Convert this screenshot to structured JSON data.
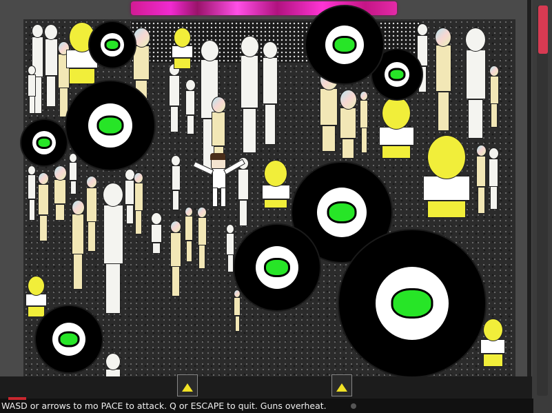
{
  "status": {
    "instructions": "WASD or arrows to mo         PACE to attack. Q or ESCAPE to quit. Guns overheat."
  },
  "boss": {
    "health": 1.0
  },
  "colors": {
    "health_bar": "#e52bc0",
    "eye_pupil": "#27e527",
    "ally_yellow": "#f1ee3a",
    "ammo": "#c9262e",
    "scroll_thumb": "#d73a52"
  },
  "icons": [
    "warning-triangle-icon",
    "warning-triangle-icon"
  ]
}
